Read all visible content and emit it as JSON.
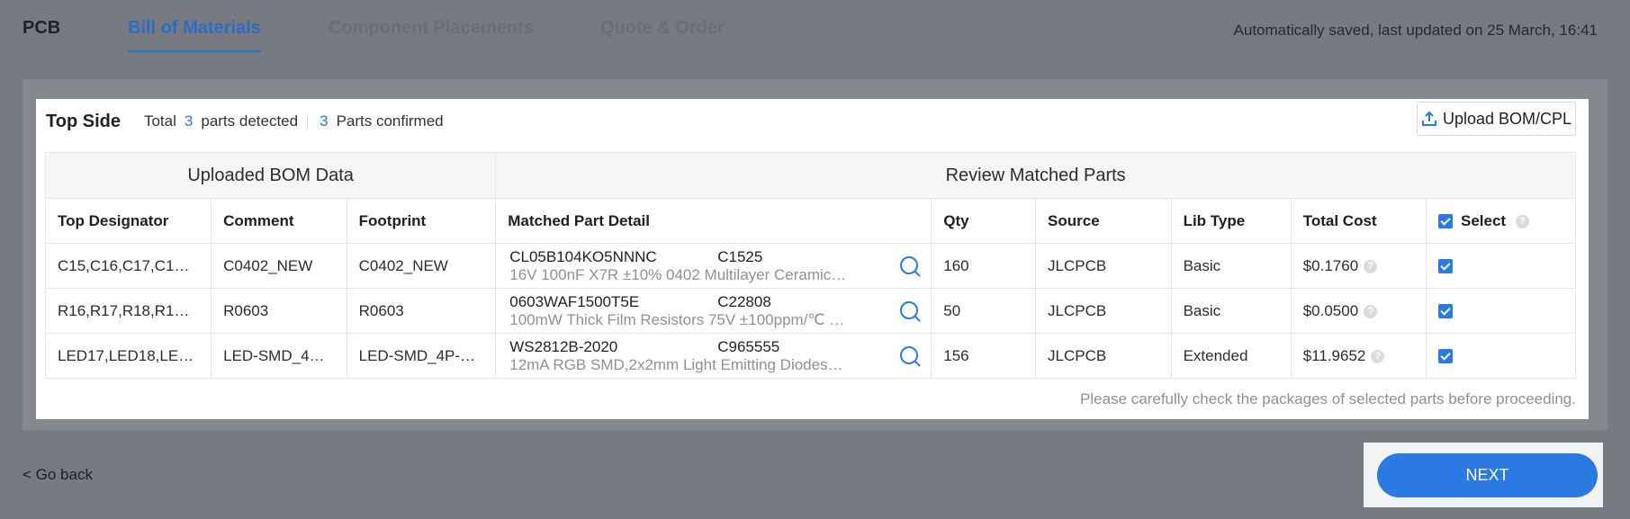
{
  "tabs": {
    "pcb": "PCB",
    "bom": "Bill of Materials",
    "placements": "Component Placements",
    "quote": "Quote & Order"
  },
  "autosave_text": "Automatically saved, last updated on 25 March, 16:41",
  "card": {
    "title": "Top Side",
    "total_prefix": "Total",
    "detected_count": "3",
    "detected_suffix": "parts detected",
    "confirmed_count": "3",
    "confirmed_suffix": "Parts confirmed",
    "upload_label": "Upload BOM/CPL"
  },
  "table": {
    "group_uploaded": "Uploaded BOM Data",
    "group_review": "Review Matched Parts",
    "headers": {
      "designator": "Top Designator",
      "comment": "Comment",
      "footprint": "Footprint",
      "matched": "Matched Part Detail",
      "qty": "Qty",
      "source": "Source",
      "libtype": "Lib Type",
      "cost": "Total Cost",
      "select": "Select"
    },
    "rows": [
      {
        "designator": "C15,C16,C17,C1…",
        "comment": "C0402_NEW",
        "footprint": "C0402_NEW",
        "part_number": "CL05B104KO5NNNC",
        "lcsc": "C1525",
        "description": "16V 100nF X7R ±10% 0402 Multilayer Ceramic…",
        "qty": "160",
        "source": "JLCPCB",
        "libtype": "Basic",
        "cost": "$0.1760"
      },
      {
        "designator": "R16,R17,R18,R1…",
        "comment": "R0603",
        "footprint": "R0603",
        "part_number": "0603WAF1500T5E",
        "lcsc": "C22808",
        "description": "100mW Thick Film Resistors 75V ±100ppm/℃ …",
        "qty": "50",
        "source": "JLCPCB",
        "libtype": "Basic",
        "cost": "$0.0500"
      },
      {
        "designator": "LED17,LED18,LE…",
        "comment": "LED-SMD_4…",
        "footprint": "LED-SMD_4P-…",
        "part_number": "WS2812B-2020",
        "lcsc": "C965555",
        "description": "12mA RGB SMD,2x2mm Light Emitting Diodes…",
        "qty": "156",
        "source": "JLCPCB",
        "libtype": "Extended",
        "cost": "$11.9652"
      }
    ]
  },
  "note": "Please carefully check the packages of selected parts before proceeding.",
  "go_back": "< Go back",
  "next_label": "NEXT",
  "colors": {
    "accent": "#2a7ae2",
    "active_tab": "#2a6ec4"
  }
}
